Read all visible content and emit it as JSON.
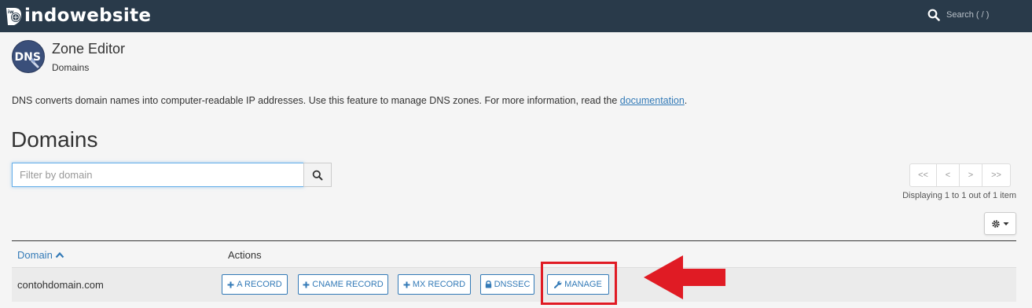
{
  "topbar": {
    "brand": "indowebsite",
    "search_placeholder": "Search ( / )"
  },
  "header": {
    "icon_label": "DNS",
    "title": "Zone Editor",
    "breadcrumb": "Domains"
  },
  "description": {
    "text": "DNS converts domain names into computer-readable IP addresses. Use this feature to manage DNS zones. For more information, read the ",
    "link": "documentation",
    "suffix": "."
  },
  "section_title": "Domains",
  "filter": {
    "placeholder": "Filter by domain"
  },
  "pagination": {
    "first": "<<",
    "prev": "<",
    "next": ">",
    "last": ">>",
    "status": "Displaying 1 to 1 out of 1 item"
  },
  "table": {
    "columns": {
      "domain": "Domain",
      "actions": "Actions"
    },
    "rows": [
      {
        "domain": "contohdomain.com",
        "actions": {
          "a_record": "A RECORD",
          "cname_record": "CNAME RECORD",
          "mx_record": "MX RECORD",
          "dnssec": "DNSSEC",
          "manage": "MANAGE"
        }
      }
    ]
  },
  "colors": {
    "topbar": "#293a4a",
    "link": "#337ab7",
    "annotation": "#e01b24"
  },
  "icons": {
    "search": "search-icon",
    "gear": "gear-icon",
    "plus": "plus-icon",
    "lock": "lock-icon",
    "wrench": "wrench-icon",
    "sort_up": "chevron-up-icon"
  }
}
